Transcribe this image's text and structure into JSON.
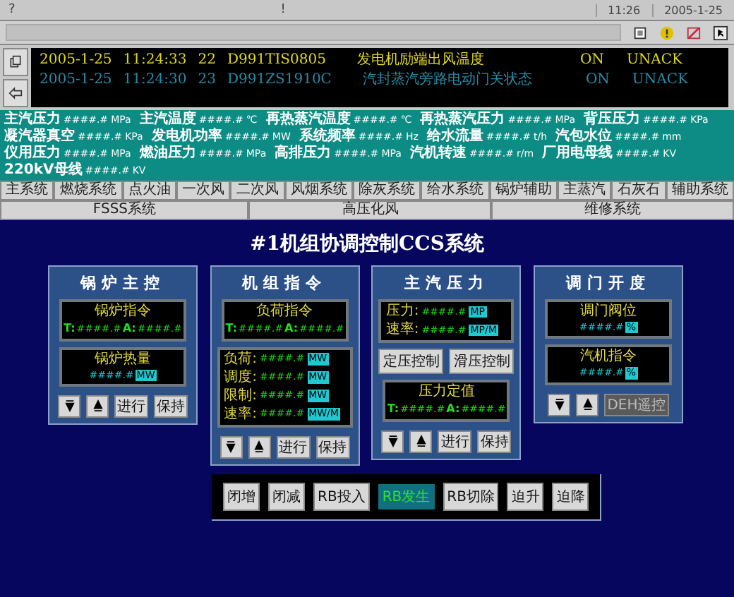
{
  "top_bar": {
    "help": "?",
    "notice": "!",
    "time": "11:26",
    "date": "2005-1-25"
  },
  "alarms": [
    {
      "date": "2005-1-25",
      "time": "11:24:33",
      "number": "22",
      "tag": "D991TIS0805",
      "description": "发电机励端出风温度",
      "state": "ON",
      "ack": "UNACK",
      "color": "#e0d820"
    },
    {
      "date": "2005-1-25",
      "time": "11:24:30",
      "number": "23",
      "tag": "D991ZS1910C",
      "description": "汽封蒸汽旁路电动门关状态",
      "state": "ON",
      "ack": "UNACK",
      "color": "#2a8aa8"
    }
  ],
  "parameters": [
    {
      "label": "主汽压力",
      "value": "####.#",
      "unit": "MPa"
    },
    {
      "label": "主汽温度",
      "value": "####.#",
      "unit": "℃"
    },
    {
      "label": "再热蒸汽温度",
      "value": "####.#",
      "unit": "℃"
    },
    {
      "label": "再热蒸汽压力",
      "value": "####.#",
      "unit": "MPa"
    },
    {
      "label": "背压压力",
      "value": "####.#",
      "unit": "KPa"
    },
    {
      "label": "凝汽器真空",
      "value": "####.#",
      "unit": "KPa"
    },
    {
      "label": "发电机功率",
      "value": "####.#",
      "unit": "MW"
    },
    {
      "label": "系统频率",
      "value": "####.#",
      "unit": "Hz"
    },
    {
      "label": "给水流量",
      "value": "####.#",
      "unit": "t/h"
    },
    {
      "label": "汽包水位",
      "value": "####.#",
      "unit": "mm"
    },
    {
      "label": "仪用压力",
      "value": "####.#",
      "unit": "MPa"
    },
    {
      "label": "燃油压力",
      "value": "####.#",
      "unit": "MPa"
    },
    {
      "label": "高排压力",
      "value": "####.#",
      "unit": "MPa"
    },
    {
      "label": "汽机转速",
      "value": "####.#",
      "unit": "r/m"
    },
    {
      "label": "厂用电母线",
      "value": "####.#",
      "unit": "KV"
    },
    {
      "label": "220kV母线",
      "value": "####.#",
      "unit": "KV"
    }
  ],
  "nav_tabs": [
    "主系统",
    "燃烧系统",
    "点火油",
    "一次风",
    "二次风",
    "风烟系统",
    "除灰系统",
    "给水系统",
    "锅炉辅助",
    "主蒸汽",
    "石灰石",
    "辅助系统",
    "FSSS系统",
    "高压化风",
    "维修系统"
  ],
  "title": "#1机组协调控制CCS系统",
  "panels": [
    {
      "title": "锅炉主控",
      "sections": [
        {
          "kind": "setpoint",
          "heading": "锅炉指令",
          "t_label": "T:",
          "t_value": "####.#",
          "a_label": "A:",
          "a_value": "####.#"
        },
        {
          "kind": "reading",
          "heading": "锅炉热量",
          "value": "####.#",
          "unit": "MW"
        }
      ],
      "buttons": [
        {
          "kind": "down",
          "disabled": false
        },
        {
          "kind": "up",
          "disabled": false
        },
        {
          "kind": "text",
          "label": "进行",
          "disabled": false
        },
        {
          "kind": "text",
          "label": "保持",
          "disabled": false
        }
      ]
    },
    {
      "title": "机组指令",
      "sections": [
        {
          "kind": "setpoint",
          "heading": "负荷指令",
          "t_label": "T:",
          "t_value": "####.#",
          "a_label": "A:",
          "a_value": "####.#"
        },
        {
          "kind": "list",
          "rows": [
            {
              "label": "负荷:",
              "value": "####.#",
              "unit": "MW"
            },
            {
              "label": "调度:",
              "value": "####.#",
              "unit": "MW"
            },
            {
              "label": "限制:",
              "value": "####.#",
              "unit": "MW"
            },
            {
              "label": "速率:",
              "value": "####.#",
              "unit": "MW/M"
            }
          ]
        }
      ],
      "buttons": [
        {
          "kind": "down",
          "disabled": false
        },
        {
          "kind": "up",
          "disabled": false
        },
        {
          "kind": "text",
          "label": "进行",
          "disabled": false
        },
        {
          "kind": "text",
          "label": "保持",
          "disabled": false
        }
      ]
    },
    {
      "title": "主汽压力",
      "sections": [
        {
          "kind": "list",
          "rows": [
            {
              "label": "压力:",
              "value": "####.#",
              "unit": "MP"
            },
            {
              "label": "速率:",
              "value": "####.#",
              "unit": "MP/M"
            }
          ]
        },
        {
          "kind": "mode_buttons",
          "labels": [
            "定压控制",
            "滑压控制"
          ]
        },
        {
          "kind": "setpoint",
          "heading": "压力定值",
          "t_label": "T:",
          "t_value": "####.#",
          "a_label": "A:",
          "a_value": "####.#"
        }
      ],
      "buttons": [
        {
          "kind": "down",
          "disabled": false
        },
        {
          "kind": "up",
          "disabled": false
        },
        {
          "kind": "text",
          "label": "进行",
          "disabled": false
        },
        {
          "kind": "text",
          "label": "保持",
          "disabled": false
        }
      ]
    },
    {
      "title": "调门开度",
      "sections": [
        {
          "kind": "reading",
          "heading": "调门阀位",
          "value": "####.#",
          "unit": "%"
        },
        {
          "kind": "reading",
          "heading": "汽机指令",
          "value": "####.#",
          "unit": "%"
        }
      ],
      "buttons": [
        {
          "kind": "down",
          "disabled": false
        },
        {
          "kind": "up",
          "disabled": false
        },
        {
          "kind": "text",
          "label": "DEH遥控",
          "disabled": true
        }
      ]
    }
  ],
  "bottom_bar": [
    {
      "kind": "button",
      "label": "闭增"
    },
    {
      "kind": "button",
      "label": "闭减"
    },
    {
      "kind": "button",
      "label": "RB投入"
    },
    {
      "kind": "indicator",
      "label": "RB发生",
      "on": true
    },
    {
      "kind": "button",
      "label": "RB切除"
    },
    {
      "kind": "button",
      "label": "迫升"
    },
    {
      "kind": "button",
      "label": "迫降"
    }
  ]
}
